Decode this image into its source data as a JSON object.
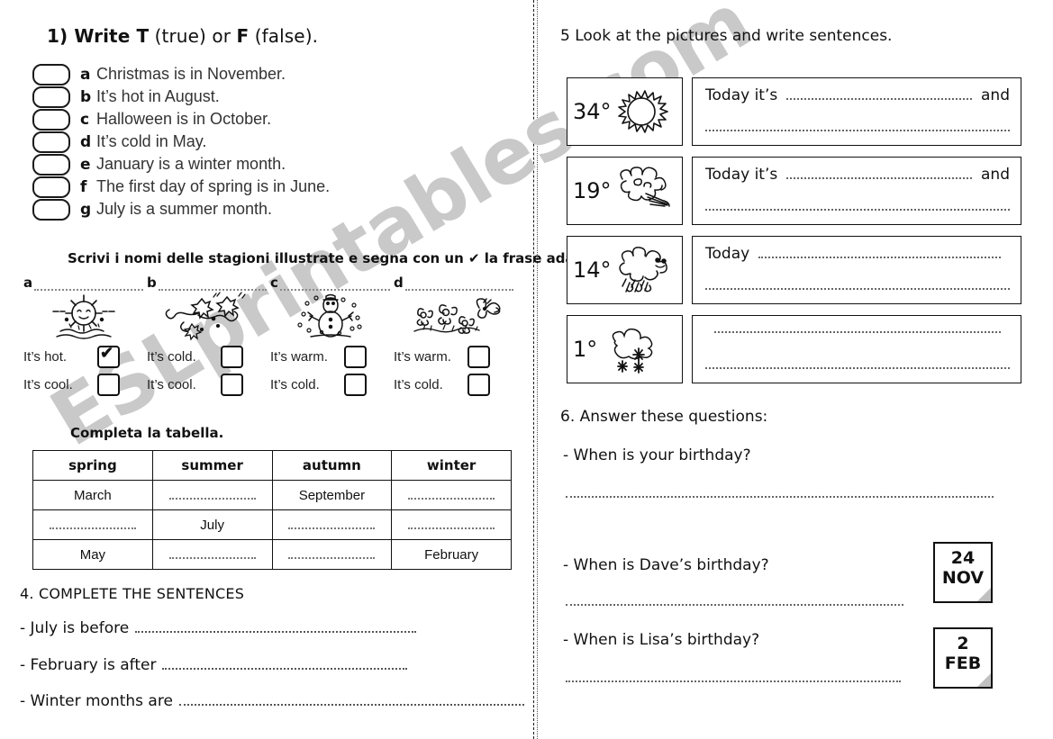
{
  "watermark": "ESLprintables.com",
  "left_column": {
    "exercise1": {
      "title_pre": "1) Write ",
      "title_t": "T",
      "title_mid": " (true) or ",
      "title_f": "F",
      "title_post": " (false).",
      "items": [
        {
          "letter": "a",
          "text": "Christmas is in November."
        },
        {
          "letter": "b",
          "text": "It’s hot in August."
        },
        {
          "letter": "c",
          "text": "Halloween is in October."
        },
        {
          "letter": "d",
          "text": "It’s cold in May."
        },
        {
          "letter": "e",
          "text": "January is a winter month."
        },
        {
          "letter": "f",
          "text": "The first day of spring is in June."
        },
        {
          "letter": "g",
          "text": "July is a summer month."
        }
      ]
    },
    "exercise2": {
      "instruction": "Scrivi i nomi delle stagioni illustrate e segna con un ✔ la frase adatta.",
      "items": [
        {
          "letter": "a",
          "answer": "",
          "picture": "sun-icon",
          "options": [
            {
              "label": "It’s hot.",
              "checked": true
            },
            {
              "label": "It’s cool.",
              "checked": false
            }
          ]
        },
        {
          "letter": "b",
          "answer": "",
          "picture": "autumn-leaves-icon",
          "options": [
            {
              "label": "It’s cold.",
              "checked": false
            },
            {
              "label": "It’s cool.",
              "checked": false
            }
          ]
        },
        {
          "letter": "c",
          "answer": "",
          "picture": "snowman-icon",
          "options": [
            {
              "label": "It’s warm.",
              "checked": false
            },
            {
              "label": "It’s cold.",
              "checked": false
            }
          ]
        },
        {
          "letter": "d",
          "answer": "",
          "picture": "flowers-butterfly-icon",
          "options": [
            {
              "label": "It’s warm.",
              "checked": false
            },
            {
              "label": "It’s cold.",
              "checked": false
            }
          ]
        }
      ]
    },
    "exercise3": {
      "instruction": "Completa la tabella.",
      "headers": [
        "spring",
        "summer",
        "autumn",
        "winter"
      ],
      "rows": [
        [
          "March",
          "",
          "September",
          ""
        ],
        [
          "",
          "July",
          "",
          ""
        ],
        [
          "May",
          "",
          "",
          "February"
        ]
      ]
    },
    "exercise4": {
      "title": "4. COMPLETE THE SENTENCES",
      "lines": [
        "- July is before",
        "- February is after",
        "- Winter months are"
      ]
    }
  },
  "right_column": {
    "exercise5": {
      "title": "5 Look at the pictures and write sentences.",
      "items": [
        {
          "temperature": "34°",
          "picture": "sun-icon",
          "lead": "Today it’s",
          "connector": "and",
          "second_line": true
        },
        {
          "temperature": "19°",
          "picture": "windy-clouds-icon",
          "lead": "Today it’s",
          "connector": "and",
          "second_line": true
        },
        {
          "temperature": "14°",
          "picture": "rain-cloud-icon",
          "lead": "Today",
          "connector": "",
          "second_line": true
        },
        {
          "temperature": "1°",
          "picture": "snow-cloud-icon",
          "lead": "",
          "connector": "",
          "second_line": true
        }
      ]
    },
    "exercise6": {
      "title": "6. Answer these questions:",
      "questions": [
        {
          "text": "- When is your birthday?",
          "card": null
        },
        {
          "text": "- When is Dave’s birthday?",
          "card": {
            "day": "24",
            "month": "NOV"
          }
        },
        {
          "text": "-  When is Lisa’s birthday?",
          "card": {
            "day": "2",
            "month": "FEB"
          }
        }
      ]
    }
  },
  "colors": {
    "ink": "#111111",
    "text_gray": "#333333",
    "dots": "#666666",
    "watermark": "#c9c9c9",
    "fold": "#c0c0c0"
  }
}
